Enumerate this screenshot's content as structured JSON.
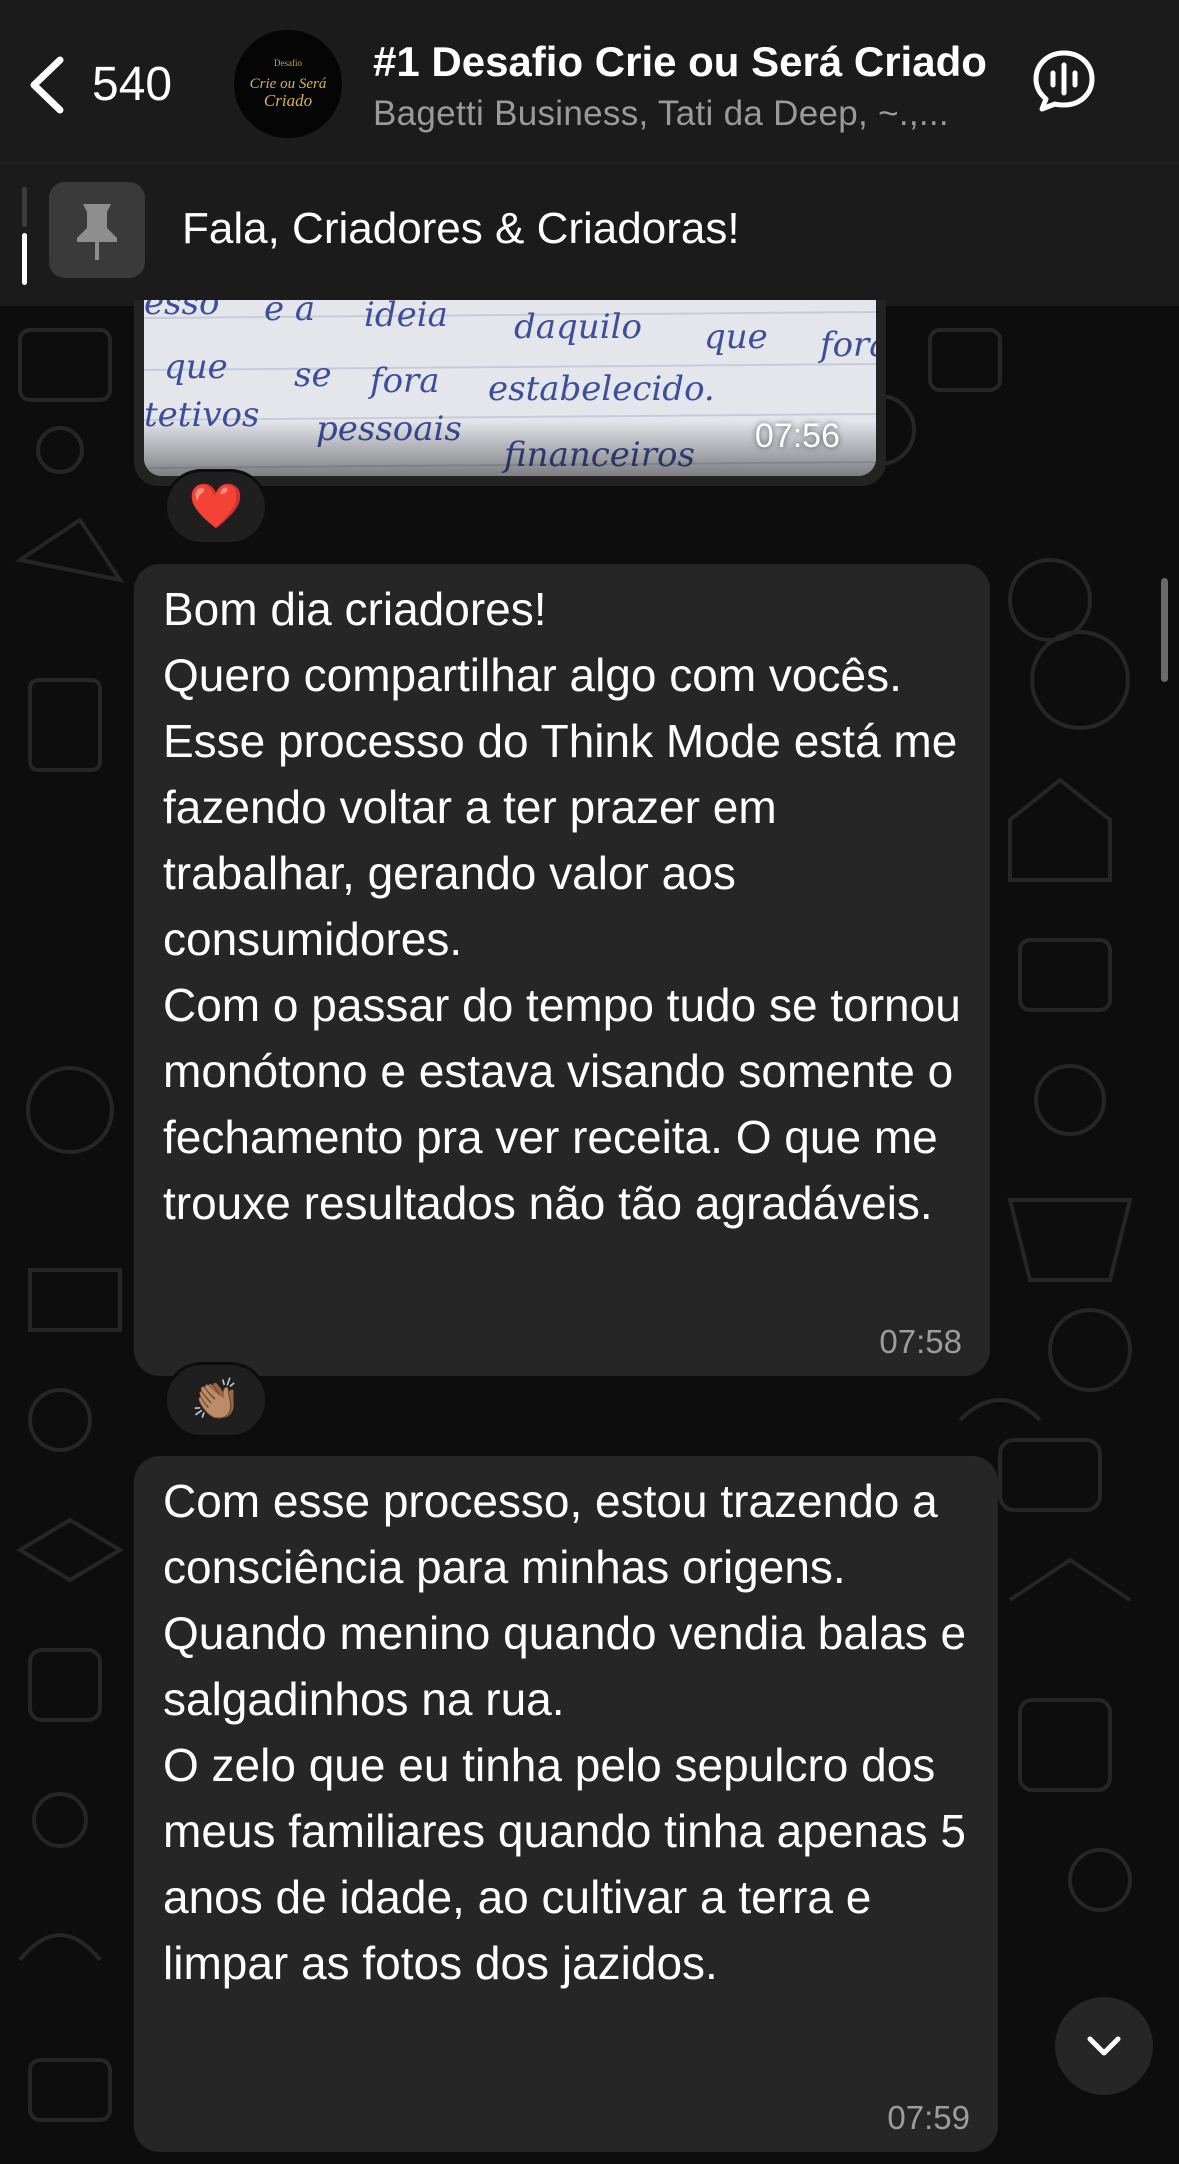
{
  "header": {
    "back_count": "540",
    "group_title": "#1 Desafio Crie ou Será Criado",
    "group_members": "Bagetti Business, Tati da Deep, ~.,...",
    "avatar_text_top": "Desafio",
    "avatar_text_main": "Crie ou Será Criado"
  },
  "pinned": {
    "text": "Fala, Criadores & Criadoras!"
  },
  "messages": [
    {
      "type": "image",
      "time": "07:56",
      "reaction": "❤️"
    },
    {
      "type": "text",
      "text": "Bom dia criadores!\nQuero compartilhar algo com vocês. Esse processo do Think Mode está me fazendo voltar a ter prazer em trabalhar, gerando valor aos consumidores.\nCom o passar do tempo tudo se tornou monótono e estava visando somente o fechamento pra ver receita. O que me trouxe resultados não tão agradáveis.",
      "time": "07:58",
      "reaction": "👏🏽"
    },
    {
      "type": "text",
      "text": "Com esse processo, estou trazendo a consciência para minhas origens. Quando menino quando vendia balas e salgadinhos na rua.\nO zelo que eu tinha pelo sepulcro dos meus familiares quando tinha apenas 5 anos de idade, ao cultivar a terra e limpar as fotos dos jazidos.",
      "time": "07:59"
    }
  ],
  "colors": {
    "background": "#0d0d0d",
    "header": "#1b1b1b",
    "bubble": "#262626",
    "secondary_text": "#9a9a9a"
  }
}
